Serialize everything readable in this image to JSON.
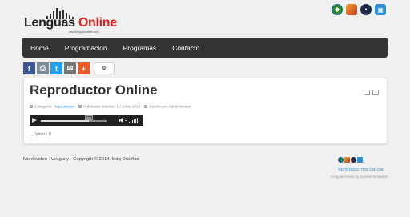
{
  "logo": {
    "text_part1": "Lenguas",
    "text_part2": "Online",
    "subtext": "www.lenguasonline.com"
  },
  "top_icons": [
    "radio-icon",
    "wand-icon",
    "mic-icon",
    "info-icon"
  ],
  "nav": {
    "items": [
      {
        "label": "Home"
      },
      {
        "label": "Programacion"
      },
      {
        "label": "Programas"
      },
      {
        "label": "Contacto"
      }
    ]
  },
  "share": {
    "icons": [
      "facebook-icon",
      "print-icon",
      "twitter-icon",
      "email-icon",
      "plus-icon"
    ],
    "count": "0"
  },
  "article": {
    "title": "Reproductor Online",
    "category_label": "Categoría:",
    "category_value": "Reproductor",
    "published": "Publicado: Martes, 10 Junio 2014",
    "author": "Escrito por Administrator",
    "player": {
      "handle_label": "0:00",
      "progress": 0.73
    },
    "views": "Visto : 0"
  },
  "footer": {
    "copyright": "Montevideo - Uruguay - Copyright © 2014. Mdq Diseños",
    "link": "REPRODUCTOR ONLINE",
    "credit": "Lenguas Online by Joomla! Templates"
  },
  "colors": {
    "nav_bg": "#333333",
    "brand_red": "#e01e1e",
    "link_blue": "#2a8fd6",
    "facebook": "#3b5998",
    "twitter": "#1da1f2",
    "addthis": "#f05a28"
  }
}
